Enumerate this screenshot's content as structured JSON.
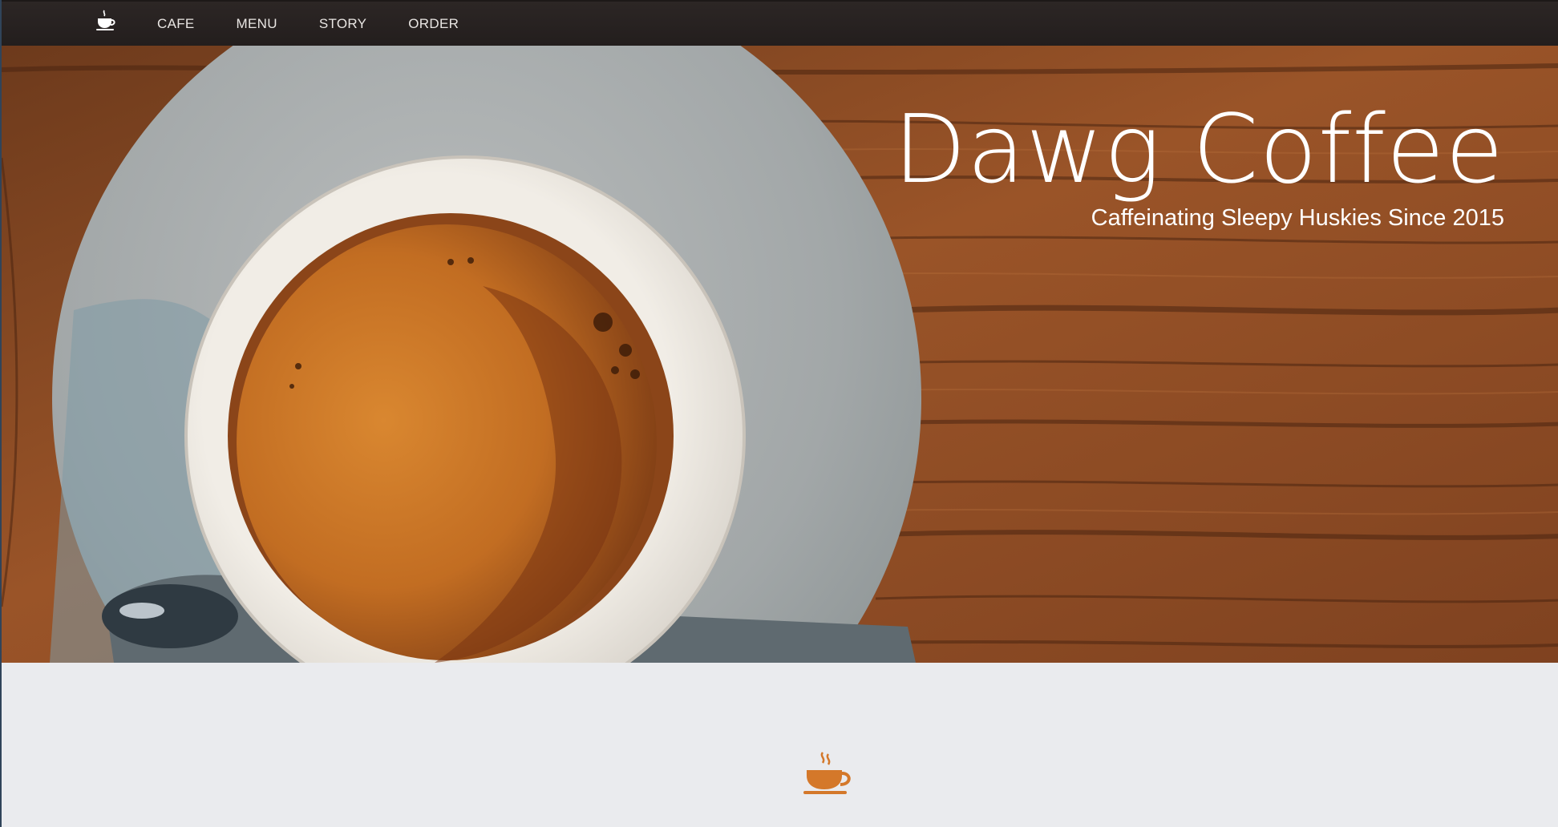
{
  "nav": {
    "brand_icon": "coffee-cup-icon",
    "links": [
      {
        "label": "CAFE"
      },
      {
        "label": "MENU"
      },
      {
        "label": "STORY"
      },
      {
        "label": "ORDER"
      }
    ]
  },
  "hero": {
    "title": "Dawg Coffee",
    "subtitle": "Caffeinating Sleepy Huskies Since 2015",
    "image": "espresso-cup-on-wooden-table"
  },
  "section": {
    "icon": "coffee-cup-icon",
    "accent_color": "#d4782a"
  },
  "colors": {
    "navbar": "#272120",
    "hero_text": "#ffffff",
    "section_bg": "#eaebee"
  }
}
